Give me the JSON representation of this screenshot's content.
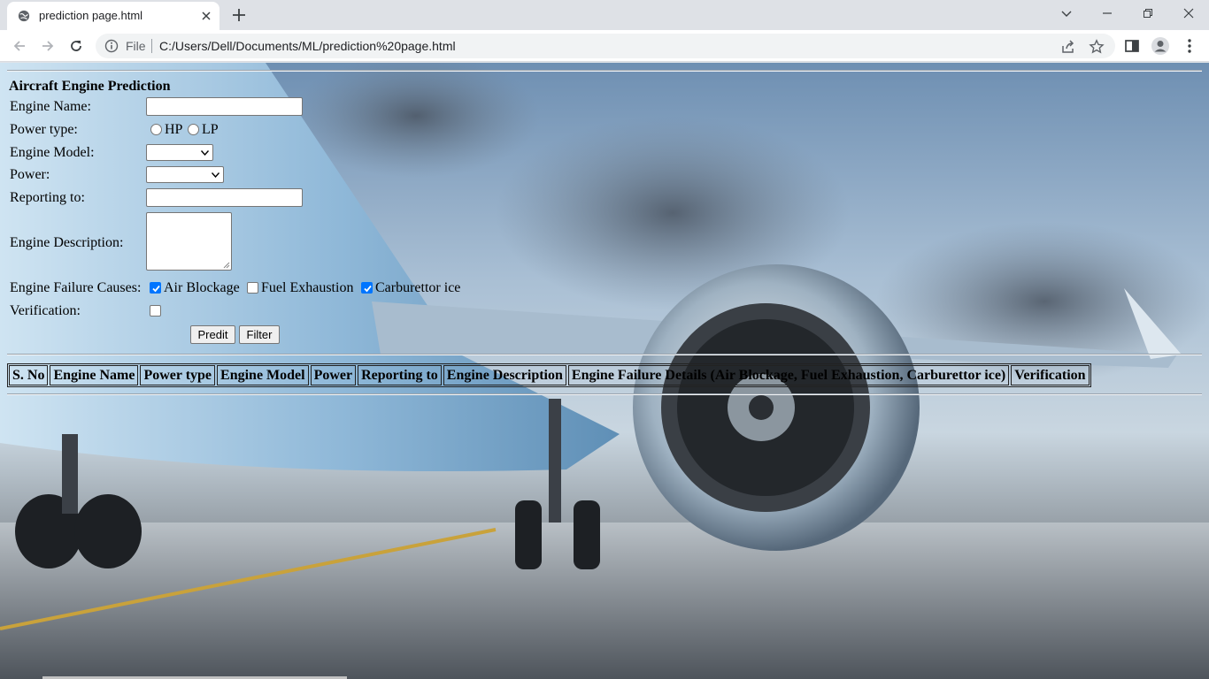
{
  "browser": {
    "tab_title": "prediction page.html",
    "scheme": "File",
    "url": "C:/Users/Dell/Documents/ML/prediction%20page.html",
    "icons": [
      "globe-icon",
      "close-icon",
      "plus-icon",
      "chevron-down-icon",
      "minimize-icon",
      "restore-icon",
      "window-close-icon",
      "back-icon",
      "forward-icon",
      "reload-icon",
      "info-icon",
      "share-icon",
      "star-icon",
      "side-panel-icon",
      "profile-icon",
      "kebab-menu-icon"
    ]
  },
  "form": {
    "title": "Aircraft Engine Prediction",
    "engine_name_label": "Engine Name:",
    "engine_name_value": "",
    "power_type_label": "Power type:",
    "power_type_options": [
      "HP",
      "LP"
    ],
    "engine_model_label": "Engine Model:",
    "engine_model_value": "",
    "power_label": "Power:",
    "power_value": "",
    "reporting_label": "Reporting to:",
    "reporting_value": "",
    "description_label": "Engine Description:",
    "description_value": "",
    "failure_label": "Engine Failure Causes:",
    "failure_options": [
      {
        "label": "Air Blockage",
        "checked": true
      },
      {
        "label": "Fuel Exhaustion",
        "checked": false
      },
      {
        "label": "Carburettor ice",
        "checked": true
      }
    ],
    "verification_label": "Verification:",
    "verification_checked": false,
    "predict_button": "Predit",
    "filter_button": "Filter"
  },
  "table": {
    "headers": [
      "S. No",
      "Engine Name",
      "Power type",
      "Engine Model",
      "Power",
      "Reporting to",
      "Engine Description",
      "Engine Failure Details (Air Blockage, Fuel Exhaustion, Carburettor ice)",
      "Verification"
    ]
  },
  "colors": {
    "checkbox_accent": "#0075ff",
    "chrome_bg": "#dee1e6"
  }
}
